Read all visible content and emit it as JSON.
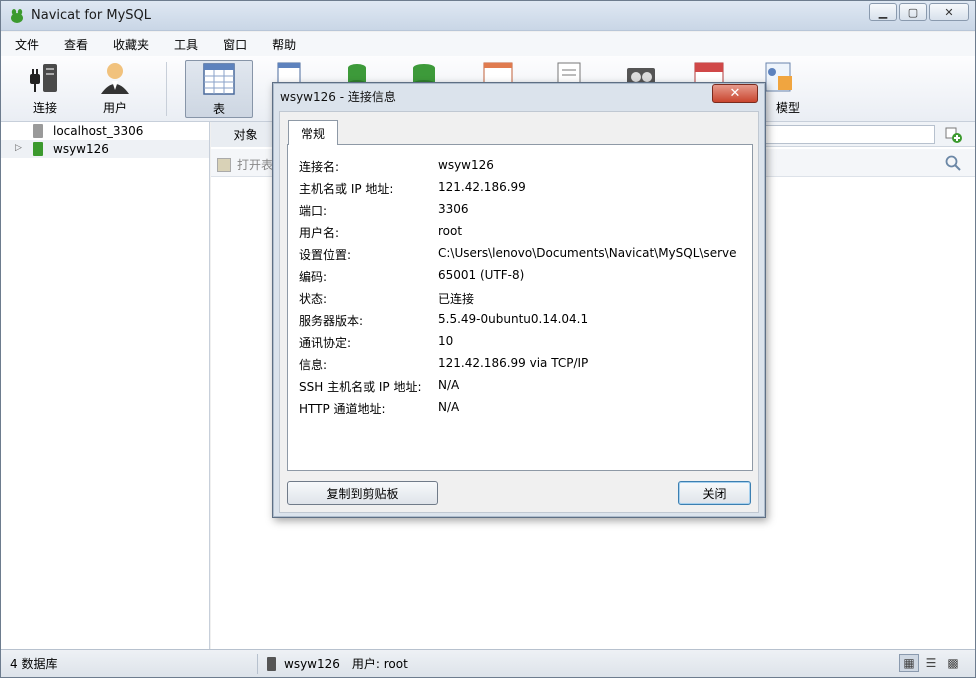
{
  "window": {
    "title": "Navicat for MySQL"
  },
  "menu": [
    "文件",
    "查看",
    "收藏夹",
    "工具",
    "窗口",
    "帮助"
  ],
  "toolbar": {
    "connect": "连接",
    "user": "用户",
    "table": "表",
    "model": "模型"
  },
  "nav": {
    "items": [
      {
        "label": "localhost_3306"
      },
      {
        "label": "wsyw126"
      }
    ]
  },
  "content": {
    "objects_tab": "对象",
    "open_table": "打开表"
  },
  "status": {
    "db_count": "4 数据库",
    "connection": "wsyw126",
    "user": "用户: root"
  },
  "dialog": {
    "title": "wsyw126 - 连接信息",
    "tab": "常规",
    "rows": [
      {
        "key": "连接名:",
        "value": "wsyw126"
      },
      {
        "key": "主机名或 IP 地址:",
        "value": "121.42.186.99"
      },
      {
        "key": "端口:",
        "value": "3306"
      },
      {
        "key": "用户名:",
        "value": "root"
      },
      {
        "key": "设置位置:",
        "value": "C:\\Users\\lenovo\\Documents\\Navicat\\MySQL\\serve"
      },
      {
        "key": "编码:",
        "value": "65001 (UTF-8)"
      },
      {
        "key": "状态:",
        "value": "已连接"
      },
      {
        "key": "服务器版本:",
        "value": "5.5.49-0ubuntu0.14.04.1"
      },
      {
        "key": "通讯协定:",
        "value": "10"
      },
      {
        "key": "信息:",
        "value": "121.42.186.99 via TCP/IP"
      },
      {
        "key": "SSH 主机名或 IP 地址:",
        "value": "N/A"
      },
      {
        "key": "HTTP 通道地址:",
        "value": "N/A"
      }
    ],
    "copy_button": "复制到剪贴板",
    "close_button": "关闭"
  },
  "colors": {
    "title_bar": "#c9d6e6",
    "dialog_close": "#c9462f",
    "server_green": "#3c9a2e",
    "accent_blue": "#3c7fb1"
  }
}
